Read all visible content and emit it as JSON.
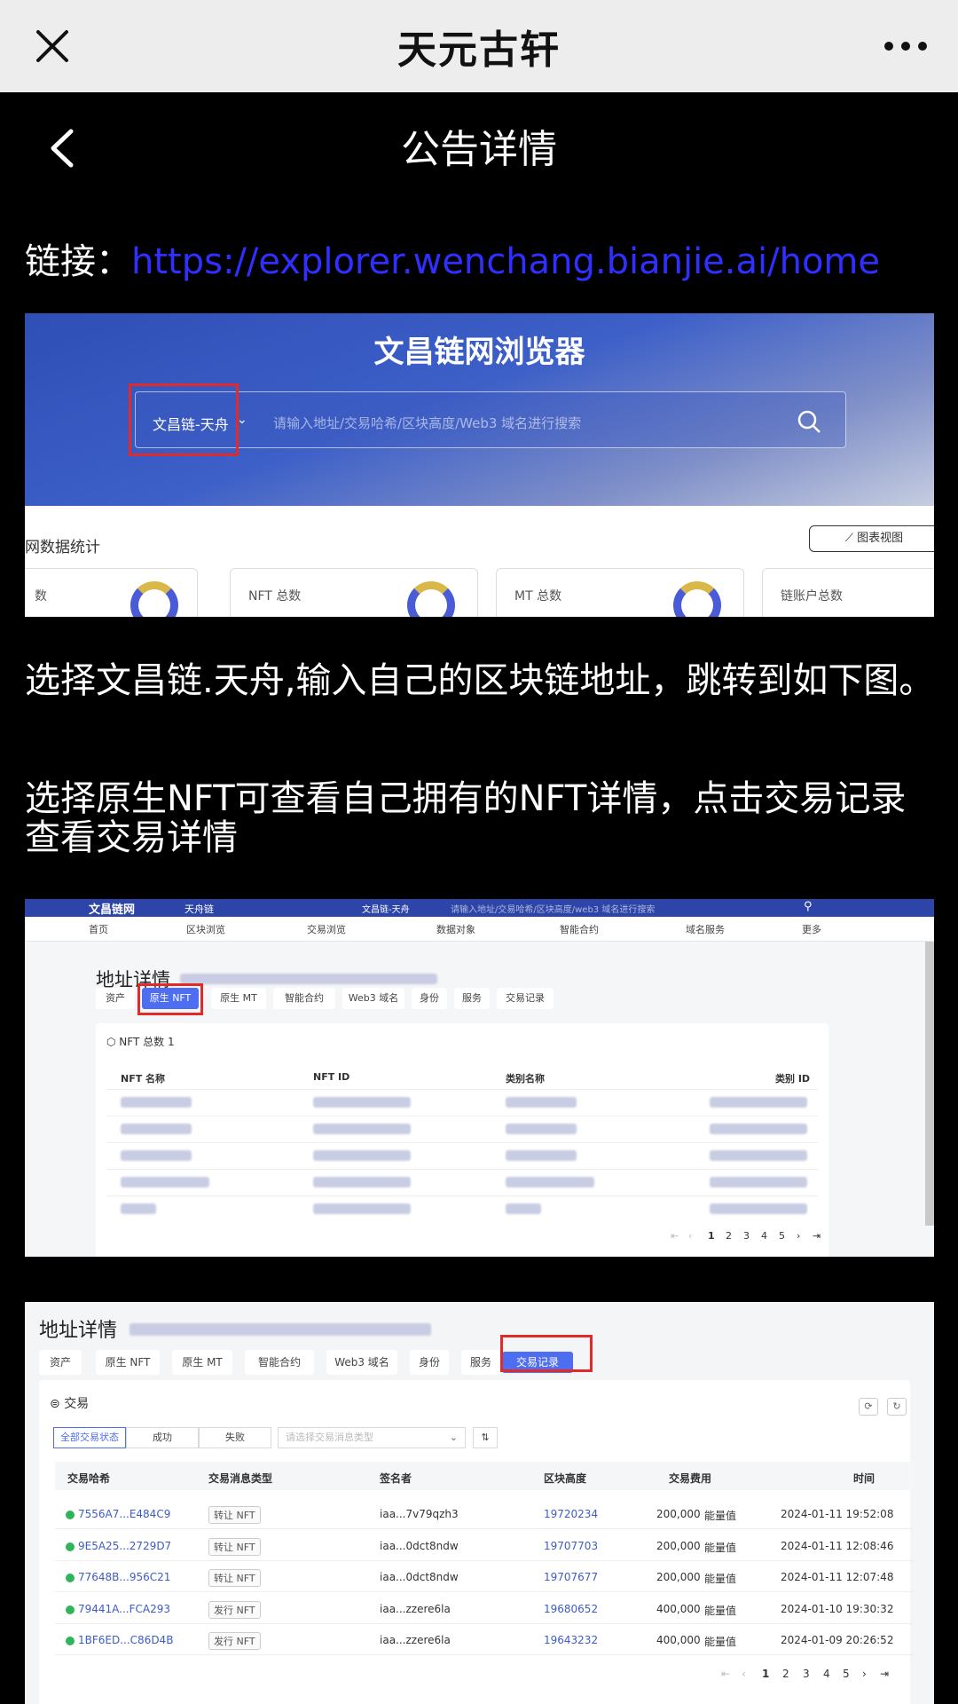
{
  "topbar": {
    "title": "天元古轩"
  },
  "nav": {
    "title": "公告详情"
  },
  "link": {
    "label": "链接：",
    "url": "https://explorer.wenchang.bianjie.ai/home"
  },
  "shot1": {
    "title": "文昌链网浏览器",
    "chain_selected": "文昌链-天舟",
    "search_placeholder": "请输入地址/交易哈希/区块高度/Web3 域名进行搜索",
    "stats_title": "网数据统计",
    "chart_view_button": "图表视图",
    "cards": [
      "数",
      "NFT 总数",
      "MT 总数",
      "链账户总数"
    ]
  },
  "para1": "选择文昌链.天舟,输入自己的区块链地址，跳转到如下图。",
  "para2": "选择原生NFT可查看自己拥有的NFT详情，点击交易记录查看交易详情",
  "shot2": {
    "logo": "文昌链网",
    "chain_tag": "天舟链",
    "chain_selected": "文昌链-天舟",
    "search_placeholder": "请输入地址/交易哈希/区块高度/web3 域名进行搜索",
    "nav": [
      "首页",
      "区块浏览",
      "交易浏览",
      "数据对象",
      "智能合约",
      "域名服务",
      "更多"
    ],
    "address_title": "地址详情",
    "tabs": [
      "资产",
      "原生 NFT",
      "原生 MT",
      "智能合约",
      "Web3 域名",
      "身份",
      "服务",
      "交易记录"
    ],
    "nft_total": "NFT 总数",
    "nft_count": "1",
    "columns": [
      "NFT 名称",
      "NFT ID",
      "类别名称",
      "类别 ID"
    ],
    "pager": [
      "1",
      "2",
      "3",
      "4",
      "5"
    ]
  },
  "shot3": {
    "address_title": "地址详情",
    "tabs": [
      "资产",
      "原生 NFT",
      "原生 MT",
      "智能合约",
      "Web3 域名",
      "身份",
      "服务",
      "交易记录"
    ],
    "panel_title": "交易",
    "filters": [
      "全部交易状态",
      "成功",
      "失败"
    ],
    "filter_placeholder": "请选择交易消息类型",
    "columns": [
      "交易哈希",
      "交易消息类型",
      "签名者",
      "区块高度",
      "交易费用",
      "时间"
    ],
    "rows": [
      {
        "hash": "7556A7...E484C9",
        "type": "转让 NFT",
        "signer": "iaa...7v79qzh3",
        "height": "19720234",
        "fee": "200,000",
        "unit": "能量值",
        "time": "2024-01-11 19:52:08"
      },
      {
        "hash": "9E5A25...2729D7",
        "type": "转让 NFT",
        "signer": "iaa...0dct8ndw",
        "height": "19707703",
        "fee": "200,000",
        "unit": "能量值",
        "time": "2024-01-11 12:08:46"
      },
      {
        "hash": "77648B...956C21",
        "type": "转让 NFT",
        "signer": "iaa...0dct8ndw",
        "height": "19707677",
        "fee": "200,000",
        "unit": "能量值",
        "time": "2024-01-11 12:07:48"
      },
      {
        "hash": "79441A...FCA293",
        "type": "发行 NFT",
        "signer": "iaa...zzere6la",
        "height": "19680652",
        "fee": "400,000",
        "unit": "能量值",
        "time": "2024-01-10 19:30:32"
      },
      {
        "hash": "1BF6ED...C86D4B",
        "type": "发行 NFT",
        "signer": "iaa...zzere6la",
        "height": "19643232",
        "fee": "400,000",
        "unit": "能量值",
        "time": "2024-01-09 20:26:52"
      }
    ],
    "pager": [
      "1",
      "2",
      "3",
      "4",
      "5"
    ]
  }
}
